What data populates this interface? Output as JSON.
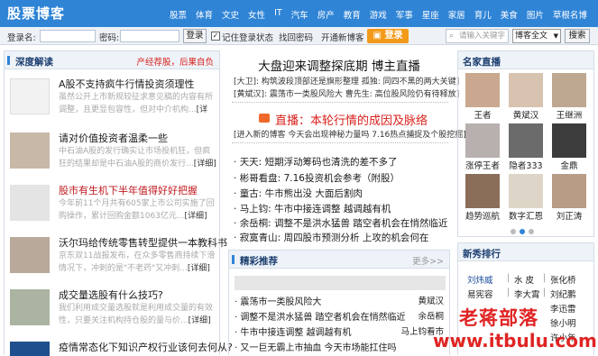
{
  "header": {
    "logo": "股票博客",
    "nav": [
      "股票",
      "体育",
      "文史",
      "女性",
      "IT",
      "汽车",
      "房产",
      "教育",
      "游戏",
      "军事",
      "星座",
      "家居",
      "育儿",
      "美食",
      "图片",
      "草根名博"
    ]
  },
  "login": {
    "user_label": "登录名:",
    "pass_label": "密码:",
    "login_btn": "登录",
    "remember": "记住登录状态",
    "forgot": "找回密码",
    "open_blog": "开通新博客",
    "orange_btn": "登录",
    "search_placeholder": "请输入关键字",
    "scope": "博客全文",
    "search_btn": "搜索"
  },
  "left": {
    "title": "深度解读",
    "right_links": "产经荐股，后果自负",
    "articles": [
      {
        "title": "A股不支持疯牛行情投资须理性",
        "desc": "虽然公开上市新规较征求意见稿的内容有所调整，且更显包容性，但对中介机构...",
        "more": "[详细]"
      },
      {
        "title": "请对价值投资者温柔一些",
        "desc": "中石油A股的发行确实让市场投机狂，但疯狂的结果却是中石油A股的商价发行...",
        "more": "[详细]"
      },
      {
        "title": "股市有生机下半年值得好好把握",
        "desc": "今年前11个月共有605家上市公司实施了回购操作，累计回购金额1063亿元...",
        "more": "[详细]"
      },
      {
        "title": "沃尔玛给传统零售转型提供一本教科书",
        "desc": "京东双11战报发布，在众多零售商持续下滑情况下，冲刺的是\"不老药\"又冲刺...",
        "more": "[详细]"
      },
      {
        "title": "成交量选股有什么技巧?",
        "desc": "我们利用成交量选股就是利用成交量的有效性，只要关注机构持仓股的量与价...",
        "more": "[详细]"
      },
      {
        "title": "疫情常态化下知识产权行业该何去何从?",
        "desc": "",
        "more": ""
      }
    ]
  },
  "mid": {
    "title": "大盘迎来调整探底期 博主直播",
    "sub1": "[大卫]: 构筑波段顶部还是旗形整理 孤独: 同四不黑的两大关键]",
    "sub2": "[黄斌汉]: 震荡市一类股风险大 曹先生: 高位股风险仍有待释放]",
    "live": "直播：本轮行情的成因及脉络",
    "live_sub": "[进入新的博客 今天会出现神秘力量吗 7.16热点捕捉及个股挖掘]",
    "bullets": [
      "天天: 短期浮动筹码也清洗的差不多了",
      "彬哥看盘: 7.16投资机会参考（附股）",
      "童古: 牛市熊出没 大面后割肉",
      "马上钧: 牛市中接连调整 越调越有机",
      "余岳桐: 调整不是洪水猛兽 踏空者机会在悄然临近",
      "寂寞青山: 周四股市预测分析 上攻的机会何在"
    ],
    "rec_title": "精彩推荐",
    "rec_more": "更多>>",
    "rec_rows": [
      {
        "t": "震荡市一类股风险大",
        "a": "黄斌汉"
      },
      {
        "t": "调整不是洪水猛兽 踏空者机会在悄然临近",
        "a": "余岳桐"
      },
      {
        "t": "牛市中接连调整 越调越有机",
        "a": "马上钧看市"
      },
      {
        "t": "又一巨无霸上市抽血 今天市场能扛住吗",
        "a": ""
      }
    ]
  },
  "right": {
    "title": "名家直播",
    "people": [
      "王者",
      "黄斌汉",
      "王继洲",
      "涨停王者",
      "隐者333",
      "金鼎",
      "趋势巡航",
      "数字汇恩",
      "刘正涛"
    ],
    "rank_title": "新秀排行",
    "rank": [
      [
        "刘炜威",
        "水 皮",
        "张化桥"
      ],
      [
        "易宪容",
        "李大霄",
        "刘纪鹏"
      ],
      [
        "",
        "",
        "李迅雷"
      ],
      [
        "",
        "",
        "徐小明"
      ],
      [
        "",
        "",
        "许小年"
      ]
    ]
  },
  "watermark": {
    "line1": "老蒋部落",
    "line2": "www.itbulu.com"
  }
}
